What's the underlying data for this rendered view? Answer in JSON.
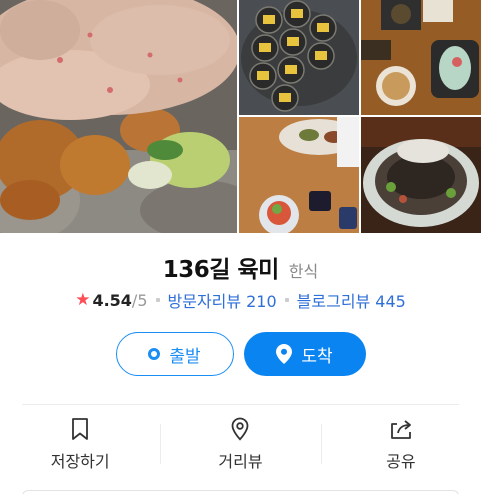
{
  "place": {
    "name": "136길 육미",
    "category": "한식",
    "rating": "4.54",
    "rating_max": "/5",
    "visitor_reviews_label": "방문자리뷰",
    "visitor_reviews_count": "210",
    "blog_reviews_label": "블로그리뷰",
    "blog_reviews_count": "445"
  },
  "route": {
    "start_label": "출발",
    "arrive_label": "도착"
  },
  "actions": [
    {
      "label": "저장하기",
      "icon": "bookmark-icon"
    },
    {
      "label": "거리뷰",
      "icon": "map-pin-icon"
    },
    {
      "label": "공유",
      "icon": "share-icon"
    }
  ],
  "colors": {
    "accent": "#0a84f0",
    "star": "#ff4d57",
    "link": "#2f6fd8"
  },
  "photos": [
    {
      "name": "photo-fried-chicken-salad"
    },
    {
      "name": "photo-kimbap"
    },
    {
      "name": "photo-table-spread"
    },
    {
      "name": "photo-side-dishes"
    },
    {
      "name": "photo-beef-dish"
    }
  ]
}
